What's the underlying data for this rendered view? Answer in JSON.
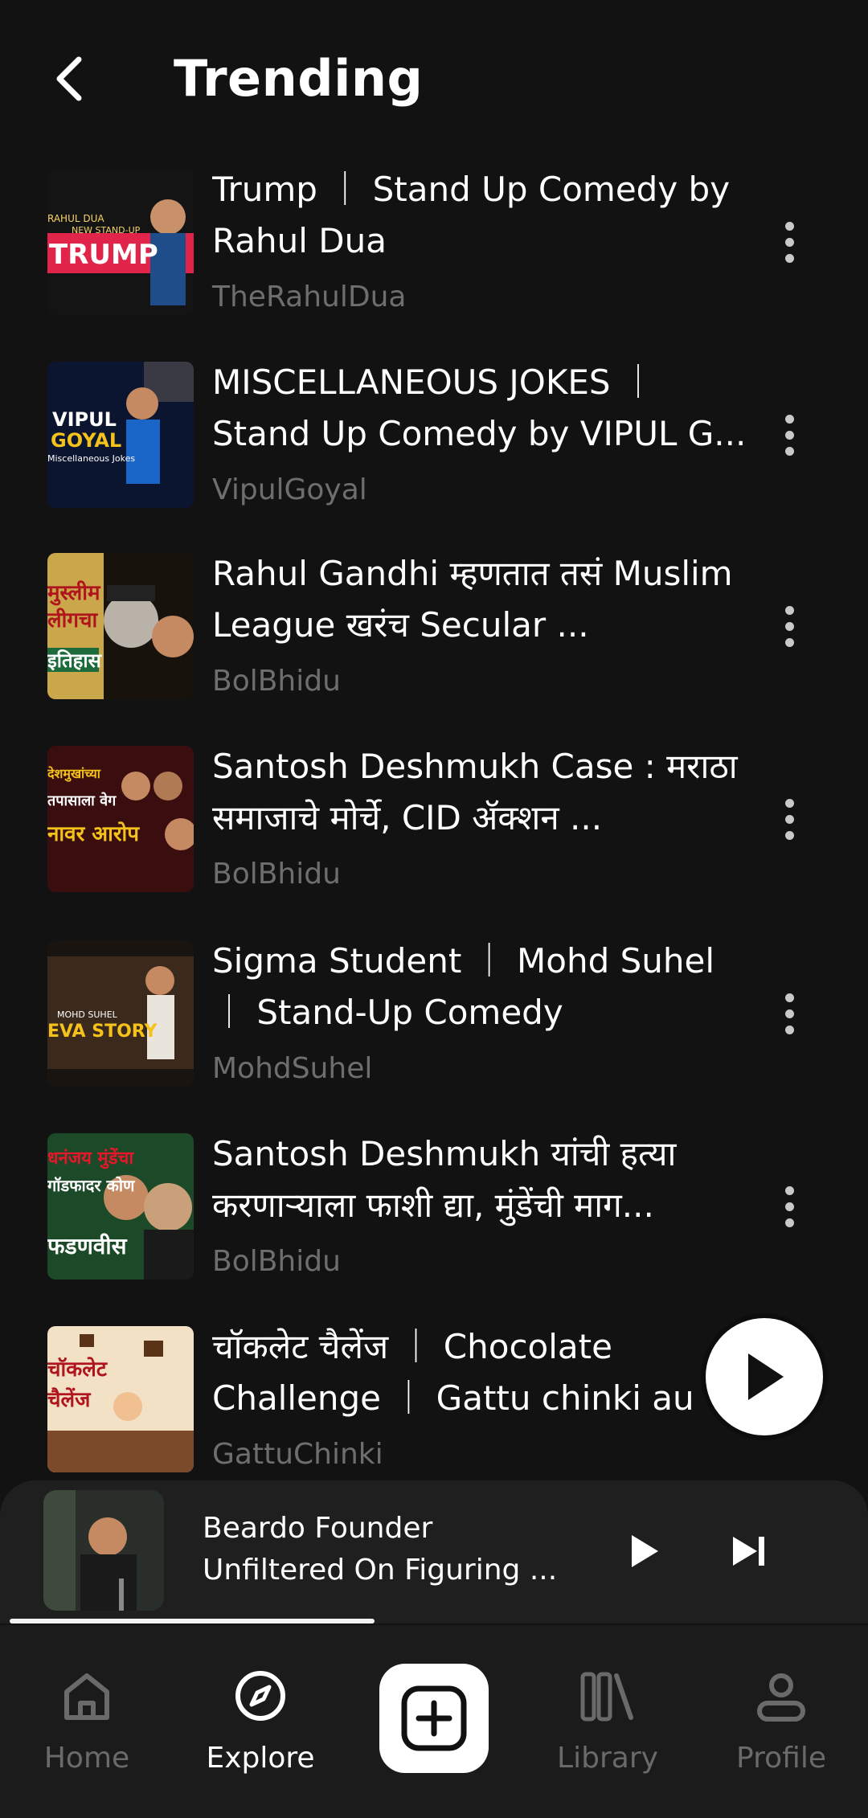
{
  "header": {
    "title": "Trending",
    "back_icon": "chevron-left-icon"
  },
  "videos": [
    {
      "title": "Trump ｜ Stand Up Comedy by Rahul Dua",
      "channel": "TheRahulDua",
      "thumb_text_1": "RAHUL DUA",
      "thumb_text_2": "NEW STAND-UP",
      "thumb_text_3": "TRUMP"
    },
    {
      "title": "MISCELLANEOUS JOKES ｜ Stand Up Comedy by VIPUL G...",
      "channel": "VipulGoyal",
      "thumb_text_1": "VIPUL",
      "thumb_text_2": "GOYAL",
      "thumb_text_3": "Miscellaneous Jokes"
    },
    {
      "title": "Rahul Gandhi म्हणतात तसं Muslim League खरंच Secular ...",
      "channel": "BolBhidu",
      "thumb_text_1": "मुस्लीम",
      "thumb_text_2": "लीगचा",
      "thumb_text_3": "इतिहास"
    },
    {
      "title": "Santosh Deshmukh Case : मराठा समाजाचे मोर्चे, CID ॲक्शन ...",
      "channel": "BolBhidu",
      "thumb_text_1": "देशमुखांच्या",
      "thumb_text_2": "तपासाला वेग",
      "thumb_text_3": "नावर आरोप"
    },
    {
      "title": "Sigma Student ｜ Mohd Suhel ｜ Stand-Up Comedy",
      "channel": "MohdSuhel",
      "thumb_text_1": "MOHD SUHEL",
      "thumb_text_2": "EVA STORY",
      "thumb_text_3": ""
    },
    {
      "title": "Santosh Deshmukh यांची हत्या करणाऱ्याला फाशी द्या, मुंडेंची माग...",
      "channel": "BolBhidu",
      "thumb_text_1": "धनंजय मुंडेंचा",
      "thumb_text_2": "गॉडफादर कोण",
      "thumb_text_3": "फडणवीस"
    },
    {
      "title": "चॉकलेट चैलेंज ｜ Chocolate Challenge ｜ Gattu chinki au",
      "channel": "GattuChinki",
      "thumb_text_1": "चॉकलेट",
      "thumb_text_2": "चैलेंज",
      "thumb_text_3": ""
    }
  ],
  "more_icon": "more-vertical-icon",
  "fab": {
    "icon": "play-icon"
  },
  "mini_player": {
    "title_line_1": "Beardo Founder",
    "title_line_2": "Unfiltered On Figuring ...",
    "progress": 0.43,
    "play_icon": "play-icon",
    "next_icon": "skip-next-icon"
  },
  "nav": {
    "items": [
      {
        "label": "Home",
        "icon": "home-icon",
        "active": false
      },
      {
        "label": "Explore",
        "icon": "compass-icon",
        "active": true
      },
      {
        "label": "",
        "icon": "plus-square-icon",
        "active": false
      },
      {
        "label": "Library",
        "icon": "library-icon",
        "active": false
      },
      {
        "label": "Profile",
        "icon": "profile-icon",
        "active": false
      }
    ]
  },
  "colors": {
    "background": "#121212",
    "text_primary": "#ffffff",
    "text_secondary": "#6e6e6e",
    "nav_inactive": "#6a6a6a",
    "mini_player_bg": "#1f1f1f"
  }
}
